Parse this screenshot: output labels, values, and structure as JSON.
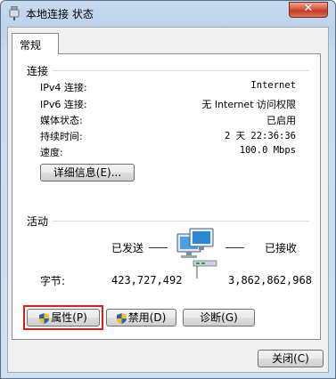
{
  "window": {
    "title": "本地连接 状态",
    "close_label": "✕"
  },
  "tabs": [
    {
      "label": "常规"
    }
  ],
  "connection": {
    "section_title": "连接",
    "rows": [
      {
        "label": "IPv4 连接:",
        "value": "Internet"
      },
      {
        "label": "IPv6 连接:",
        "value": "无 Internet 访问权限"
      },
      {
        "label": "媒体状态:",
        "value": "已启用"
      },
      {
        "label": "持续时间:",
        "value": "2 天 22:36:36"
      },
      {
        "label": "速度:",
        "value": "100.0 Mbps"
      }
    ],
    "details_button": "详细信息(E)..."
  },
  "activity": {
    "section_title": "活动",
    "sent_label": "已发送",
    "received_label": "已接收",
    "bytes_label": "字节:",
    "bytes_sent": "423,727,492",
    "bytes_received": "3,862,862,968"
  },
  "buttons": {
    "properties": "属性(P)",
    "disable": "禁用(D)",
    "diagnose": "诊断(G)",
    "close": "关闭(C)"
  },
  "colors": {
    "highlight": "#e01b1b",
    "close_button": "#c23a22"
  },
  "icons": {
    "window": "network-adapter-icon",
    "activity": "network-computers-icon",
    "shield": "uac-shield-icon"
  }
}
